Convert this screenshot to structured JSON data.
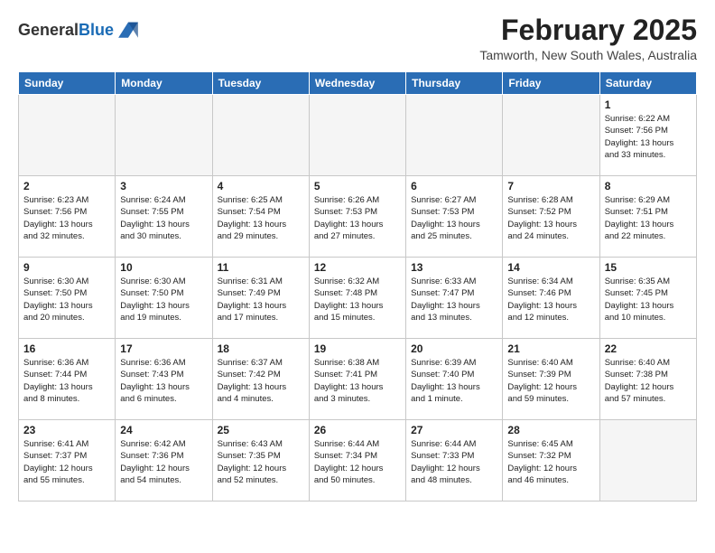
{
  "header": {
    "logo_general": "General",
    "logo_blue": "Blue",
    "month_title": "February 2025",
    "location": "Tamworth, New South Wales, Australia"
  },
  "weekdays": [
    "Sunday",
    "Monday",
    "Tuesday",
    "Wednesday",
    "Thursday",
    "Friday",
    "Saturday"
  ],
  "weeks": [
    [
      {
        "day": "",
        "info": ""
      },
      {
        "day": "",
        "info": ""
      },
      {
        "day": "",
        "info": ""
      },
      {
        "day": "",
        "info": ""
      },
      {
        "day": "",
        "info": ""
      },
      {
        "day": "",
        "info": ""
      },
      {
        "day": "1",
        "info": "Sunrise: 6:22 AM\nSunset: 7:56 PM\nDaylight: 13 hours\nand 33 minutes."
      }
    ],
    [
      {
        "day": "2",
        "info": "Sunrise: 6:23 AM\nSunset: 7:56 PM\nDaylight: 13 hours\nand 32 minutes."
      },
      {
        "day": "3",
        "info": "Sunrise: 6:24 AM\nSunset: 7:55 PM\nDaylight: 13 hours\nand 30 minutes."
      },
      {
        "day": "4",
        "info": "Sunrise: 6:25 AM\nSunset: 7:54 PM\nDaylight: 13 hours\nand 29 minutes."
      },
      {
        "day": "5",
        "info": "Sunrise: 6:26 AM\nSunset: 7:53 PM\nDaylight: 13 hours\nand 27 minutes."
      },
      {
        "day": "6",
        "info": "Sunrise: 6:27 AM\nSunset: 7:53 PM\nDaylight: 13 hours\nand 25 minutes."
      },
      {
        "day": "7",
        "info": "Sunrise: 6:28 AM\nSunset: 7:52 PM\nDaylight: 13 hours\nand 24 minutes."
      },
      {
        "day": "8",
        "info": "Sunrise: 6:29 AM\nSunset: 7:51 PM\nDaylight: 13 hours\nand 22 minutes."
      }
    ],
    [
      {
        "day": "9",
        "info": "Sunrise: 6:30 AM\nSunset: 7:50 PM\nDaylight: 13 hours\nand 20 minutes."
      },
      {
        "day": "10",
        "info": "Sunrise: 6:30 AM\nSunset: 7:50 PM\nDaylight: 13 hours\nand 19 minutes."
      },
      {
        "day": "11",
        "info": "Sunrise: 6:31 AM\nSunset: 7:49 PM\nDaylight: 13 hours\nand 17 minutes."
      },
      {
        "day": "12",
        "info": "Sunrise: 6:32 AM\nSunset: 7:48 PM\nDaylight: 13 hours\nand 15 minutes."
      },
      {
        "day": "13",
        "info": "Sunrise: 6:33 AM\nSunset: 7:47 PM\nDaylight: 13 hours\nand 13 minutes."
      },
      {
        "day": "14",
        "info": "Sunrise: 6:34 AM\nSunset: 7:46 PM\nDaylight: 13 hours\nand 12 minutes."
      },
      {
        "day": "15",
        "info": "Sunrise: 6:35 AM\nSunset: 7:45 PM\nDaylight: 13 hours\nand 10 minutes."
      }
    ],
    [
      {
        "day": "16",
        "info": "Sunrise: 6:36 AM\nSunset: 7:44 PM\nDaylight: 13 hours\nand 8 minutes."
      },
      {
        "day": "17",
        "info": "Sunrise: 6:36 AM\nSunset: 7:43 PM\nDaylight: 13 hours\nand 6 minutes."
      },
      {
        "day": "18",
        "info": "Sunrise: 6:37 AM\nSunset: 7:42 PM\nDaylight: 13 hours\nand 4 minutes."
      },
      {
        "day": "19",
        "info": "Sunrise: 6:38 AM\nSunset: 7:41 PM\nDaylight: 13 hours\nand 3 minutes."
      },
      {
        "day": "20",
        "info": "Sunrise: 6:39 AM\nSunset: 7:40 PM\nDaylight: 13 hours\nand 1 minute."
      },
      {
        "day": "21",
        "info": "Sunrise: 6:40 AM\nSunset: 7:39 PM\nDaylight: 12 hours\nand 59 minutes."
      },
      {
        "day": "22",
        "info": "Sunrise: 6:40 AM\nSunset: 7:38 PM\nDaylight: 12 hours\nand 57 minutes."
      }
    ],
    [
      {
        "day": "23",
        "info": "Sunrise: 6:41 AM\nSunset: 7:37 PM\nDaylight: 12 hours\nand 55 minutes."
      },
      {
        "day": "24",
        "info": "Sunrise: 6:42 AM\nSunset: 7:36 PM\nDaylight: 12 hours\nand 54 minutes."
      },
      {
        "day": "25",
        "info": "Sunrise: 6:43 AM\nSunset: 7:35 PM\nDaylight: 12 hours\nand 52 minutes."
      },
      {
        "day": "26",
        "info": "Sunrise: 6:44 AM\nSunset: 7:34 PM\nDaylight: 12 hours\nand 50 minutes."
      },
      {
        "day": "27",
        "info": "Sunrise: 6:44 AM\nSunset: 7:33 PM\nDaylight: 12 hours\nand 48 minutes."
      },
      {
        "day": "28",
        "info": "Sunrise: 6:45 AM\nSunset: 7:32 PM\nDaylight: 12 hours\nand 46 minutes."
      },
      {
        "day": "",
        "info": ""
      }
    ]
  ]
}
